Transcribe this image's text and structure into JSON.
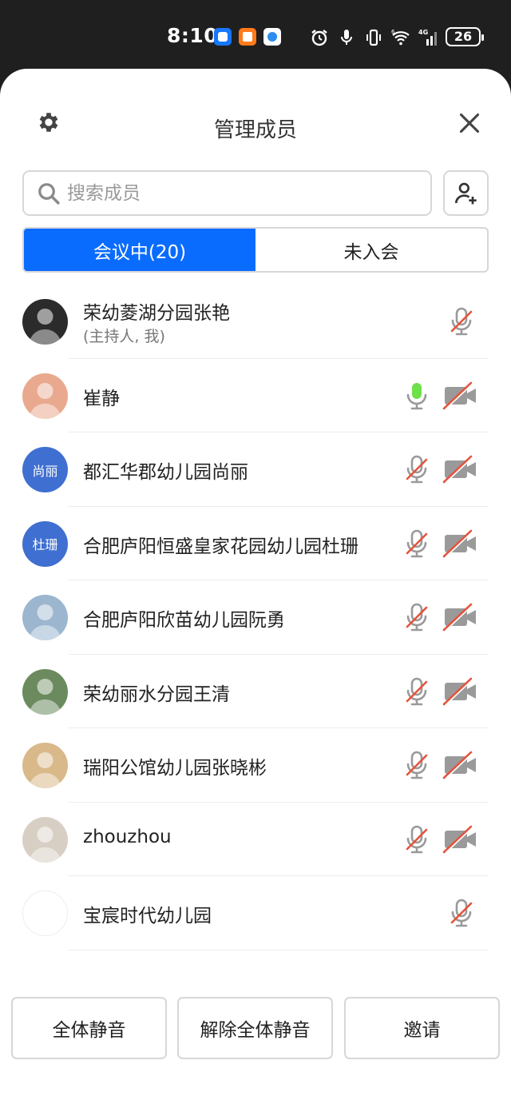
{
  "status_bar": {
    "time": "8:10",
    "network_label": "4G",
    "wifi_label": "6",
    "battery": "26"
  },
  "header": {
    "title": "管理成员"
  },
  "search": {
    "placeholder": "搜索成员"
  },
  "tabs": [
    {
      "label": "会议中(20)",
      "active": true
    },
    {
      "label": "未入会",
      "active": false
    }
  ],
  "participants": [
    {
      "name": "荣幼菱湖分园张艳",
      "sub": "(主持人, 我)",
      "avatar": "photo",
      "mic": "muted",
      "camera": "none"
    },
    {
      "name": "崔静",
      "avatar": "photo",
      "mic": "active",
      "camera": "off"
    },
    {
      "name": "都汇华郡幼儿园尚丽",
      "avatar_text": "尚丽",
      "avatar": "text",
      "mic": "muted",
      "camera": "off"
    },
    {
      "name": "合肥庐阳恒盛皇家花园幼儿园杜珊",
      "avatar_text": "杜珊",
      "avatar": "text",
      "mic": "muted",
      "camera": "off"
    },
    {
      "name": "合肥庐阳欣苗幼儿园阮勇",
      "avatar": "photo",
      "mic": "muted",
      "camera": "off"
    },
    {
      "name": "荣幼丽水分园王清",
      "avatar": "photo",
      "mic": "muted",
      "camera": "off"
    },
    {
      "name": "瑞阳公馆幼儿园张晓彬",
      "avatar": "photo",
      "mic": "muted",
      "camera": "off"
    },
    {
      "name": "zhouzhou",
      "avatar": "photo",
      "mic": "muted",
      "camera": "off"
    },
    {
      "name": "宝宸时代幼儿园",
      "avatar": "photo",
      "mic": "muted",
      "camera": "none"
    }
  ],
  "bottom_buttons": {
    "mute_all": "全体静音",
    "unmute_all": "解除全体静音",
    "invite": "邀请"
  },
  "colors": {
    "accent": "#0a6cff",
    "mic_active": "#6ee04a",
    "muted_slash": "#e5533d",
    "avatar_text_bg": "#3f6fd1"
  }
}
